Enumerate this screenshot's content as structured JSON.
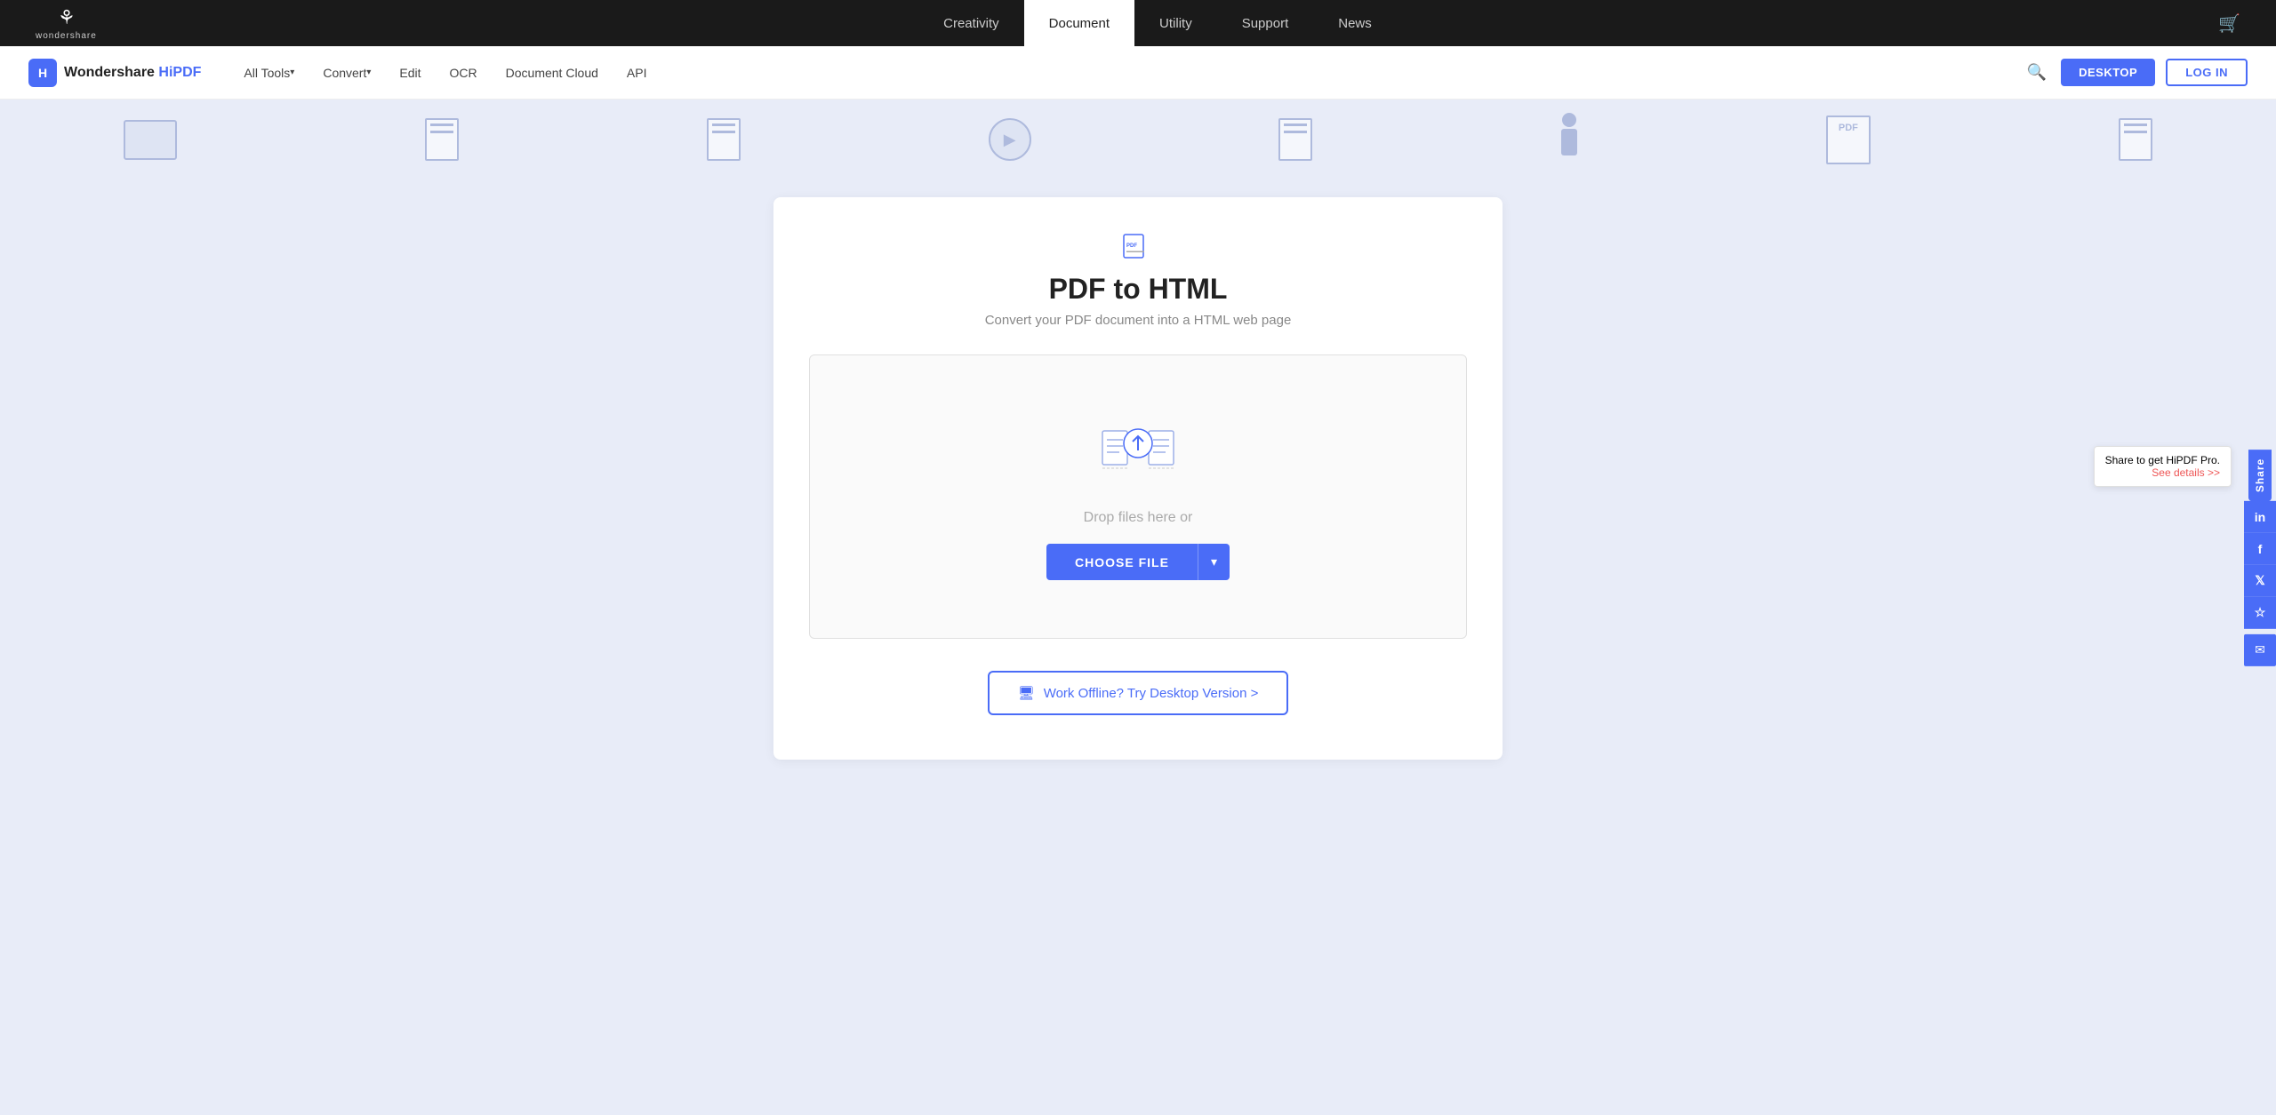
{
  "top_nav": {
    "logo_text": "wondershare",
    "links": [
      {
        "label": "Creativity",
        "active": false
      },
      {
        "label": "Document",
        "active": true
      },
      {
        "label": "Utility",
        "active": false
      },
      {
        "label": "Support",
        "active": false
      },
      {
        "label": "News",
        "active": false
      }
    ]
  },
  "secondary_nav": {
    "brand_name": "Wondershare HiPDF",
    "links": [
      {
        "label": "All Tools",
        "has_arrow": true
      },
      {
        "label": "Convert",
        "has_arrow": true
      },
      {
        "label": "Edit",
        "has_arrow": false
      },
      {
        "label": "OCR",
        "has_arrow": false
      },
      {
        "label": "Document Cloud",
        "has_arrow": false
      },
      {
        "label": "API",
        "has_arrow": false
      }
    ],
    "btn_desktop": "DESKTOP",
    "btn_login": "LOG IN"
  },
  "converter": {
    "title": "PDF to HTML",
    "subtitle": "Convert your PDF document into a HTML web page",
    "drop_text": "Drop files here or",
    "choose_file_label": "CHOOSE FILE",
    "offline_btn_label": "Work Offline? Try Desktop Version >"
  },
  "share": {
    "label": "Share",
    "promo_text": "Share to get HiPDF Pro.",
    "promo_link": "See details >>"
  },
  "icons": {
    "search": "🔍",
    "cart": "🛒",
    "linkedin": "in",
    "facebook": "f",
    "twitter": "𝕏",
    "star": "☆",
    "email": "✉",
    "monitor": "🖥",
    "upload": "↑",
    "chevron_down": "▾"
  }
}
